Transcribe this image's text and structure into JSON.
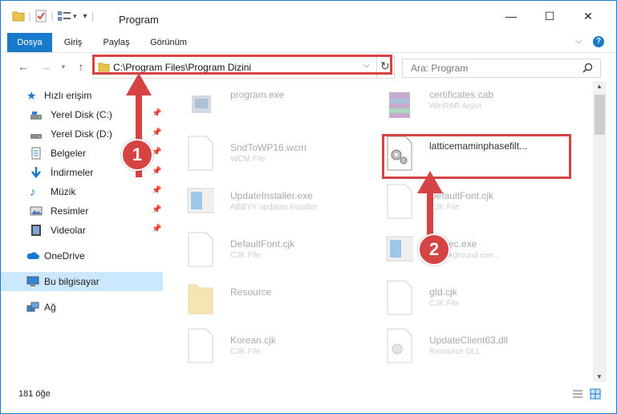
{
  "window": {
    "title": "Program",
    "controls": {
      "minimize": "—",
      "maximize": "☐",
      "close": "✕"
    }
  },
  "ribbon": {
    "tabs": [
      {
        "label": "Dosya"
      },
      {
        "label": "Giriş"
      },
      {
        "label": "Paylaş"
      },
      {
        "label": "Görünüm"
      }
    ]
  },
  "address_bar": {
    "path": "C:\\Program Files\\Program Dizini",
    "search_placeholder": "Ara: Program"
  },
  "sidebar": {
    "items": [
      {
        "label": "Hızlı erişim",
        "icon": "star-icon"
      },
      {
        "label": "Yerel Disk (C:)",
        "icon": "drive-icon"
      },
      {
        "label": "Yerel Disk (D:)",
        "icon": "drive-icon"
      },
      {
        "label": "Belgeler",
        "icon": "documents-icon"
      },
      {
        "label": "İndirmeler",
        "icon": "download-icon"
      },
      {
        "label": "Müzik",
        "icon": "music-icon"
      },
      {
        "label": "Resimler",
        "icon": "pictures-icon"
      },
      {
        "label": "Videolar",
        "icon": "videos-icon"
      },
      {
        "label": "OneDrive",
        "icon": "cloud-icon"
      },
      {
        "label": "Bu bilgisayar",
        "icon": "computer-icon"
      },
      {
        "label": "Ağ",
        "icon": "network-icon"
      }
    ]
  },
  "files": [
    {
      "name": "program.exe",
      "type": ""
    },
    {
      "name": "certificates.cab",
      "type": "WinRAR Arşivi"
    },
    {
      "name": "SndToWP16.wcm",
      "type": "WCM File"
    },
    {
      "name": "latticemaminphasefilt...",
      "type": ""
    },
    {
      "name": "UpdateInstaller.exe",
      "type": "ABBYY updates installer"
    },
    {
      "name": "DefaultFont.cjk",
      "type": "CJK File"
    },
    {
      "name": "DefaultFont.cjk",
      "type": "CJK File"
    },
    {
      "name": "...Exec.exe",
      "type": "...background exe..."
    },
    {
      "name": "Resource",
      "type": ""
    },
    {
      "name": "gtd.cjk",
      "type": "CJK File"
    },
    {
      "name": "Korean.cjk",
      "type": "CJK File"
    },
    {
      "name": "UpdateClient63.dll",
      "type": "Resource DLL"
    }
  ],
  "status": {
    "count": "181 öğe"
  },
  "annotations": {
    "badge1": "1",
    "badge2": "2"
  },
  "colors": {
    "accent": "#1979ca",
    "annotation": "#d64343",
    "selected": "#cce8ff"
  }
}
